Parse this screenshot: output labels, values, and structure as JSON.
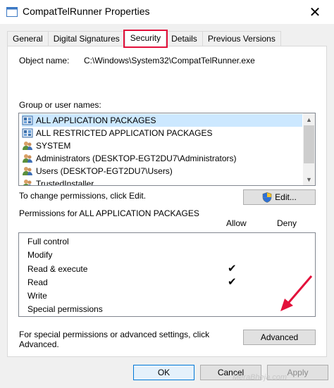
{
  "window": {
    "title": "CompatTelRunner Properties",
    "close_glyph": "✕"
  },
  "tabs": [
    {
      "label": "General"
    },
    {
      "label": "Digital Signatures"
    },
    {
      "label": "Security"
    },
    {
      "label": "Details"
    },
    {
      "label": "Previous Versions"
    }
  ],
  "security": {
    "object_name_label": "Object name:",
    "object_name_value": "C:\\Windows\\System32\\CompatTelRunner.exe",
    "group_label": "Group or user names:",
    "groups": [
      {
        "name": "ALL APPLICATION PACKAGES",
        "icon": "package-group-icon",
        "selected": true
      },
      {
        "name": "ALL RESTRICTED APPLICATION PACKAGES",
        "icon": "package-group-icon"
      },
      {
        "name": "SYSTEM",
        "icon": "users-icon"
      },
      {
        "name": "Administrators (DESKTOP-EGT2DU7\\Administrators)",
        "icon": "users-icon"
      },
      {
        "name": "Users (DESKTOP-EGT2DU7\\Users)",
        "icon": "users-icon"
      },
      {
        "name": "TrustedInstaller",
        "icon": "users-icon"
      }
    ],
    "change_text": "To change permissions, click Edit.",
    "edit_label": "Edit...",
    "permissions_for": "Permissions for ALL APPLICATION PACKAGES",
    "allow_label": "Allow",
    "deny_label": "Deny",
    "permissions": [
      {
        "name": "Full control",
        "allow": false,
        "deny": false
      },
      {
        "name": "Modify",
        "allow": false,
        "deny": false
      },
      {
        "name": "Read & execute",
        "allow": true,
        "deny": false
      },
      {
        "name": "Read",
        "allow": true,
        "deny": false
      },
      {
        "name": "Write",
        "allow": false,
        "deny": false
      },
      {
        "name": "Special permissions",
        "allow": false,
        "deny": false
      }
    ],
    "check_glyph": "✔",
    "advanced_text_1": "For special permissions or advanced settings, click",
    "advanced_text_2": "Advanced.",
    "advanced_label": "Advanced"
  },
  "footer": {
    "ok_label": "OK",
    "cancel_label": "Cancel",
    "apply_label": "Apply"
  },
  "watermark": "MeraBheja.com",
  "colors": {
    "highlight": "#e3113b",
    "selection": "#cce8ff",
    "default_button_border": "#0078d7"
  }
}
